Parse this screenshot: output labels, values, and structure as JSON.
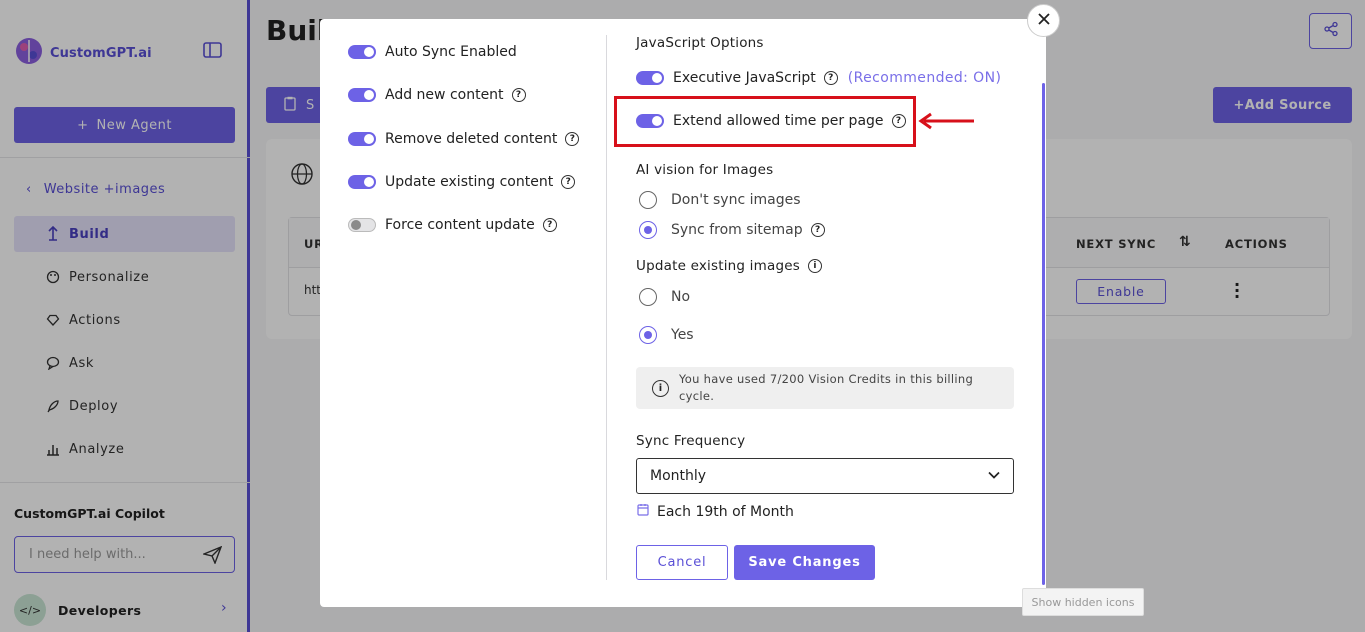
{
  "app": {
    "brand": "CustomGPT.ai",
    "accent": "#6d62e6",
    "highlight": "#d7101a"
  },
  "sidebar": {
    "new_agent": "New Agent",
    "back_link": "Website +images",
    "items": [
      {
        "label": "Build",
        "icon": "build-icon",
        "active": true
      },
      {
        "label": "Personalize",
        "icon": "palette-icon"
      },
      {
        "label": "Actions",
        "icon": "actions-icon"
      },
      {
        "label": "Ask",
        "icon": "chat-icon"
      },
      {
        "label": "Deploy",
        "icon": "rocket-icon"
      },
      {
        "label": "Analyze",
        "icon": "chart-icon"
      }
    ],
    "copilot": {
      "title": "CustomGPT.ai Copilot",
      "placeholder": "I need help with..."
    },
    "developers": {
      "avatar": "</>",
      "label": "Developers"
    }
  },
  "main": {
    "title": "Build",
    "tab": "S",
    "add_source": "Add Source",
    "table": {
      "headers": {
        "url": "UR",
        "next_sync": "NEXT SYNC",
        "actions": "ACTIONS"
      },
      "row": {
        "url": "htt",
        "enable": "Enable"
      }
    }
  },
  "modal": {
    "left_options": [
      {
        "label": "Auto Sync Enabled",
        "on": true,
        "help": false
      },
      {
        "label": "Add new content",
        "on": true,
        "help": true
      },
      {
        "label": "Remove deleted content",
        "on": true,
        "help": true
      },
      {
        "label": "Update existing content",
        "on": true,
        "help": true
      },
      {
        "label": "Force content update",
        "on": false,
        "help": true
      }
    ],
    "js": {
      "title": "JavaScript Options",
      "execute": "Executive JavaScript",
      "recommended": "(Recommended: ON)",
      "extend": "Extend allowed time per page"
    },
    "vision": {
      "title": "AI vision for Images",
      "options": [
        "Don't sync images",
        "Sync from sitemap"
      ],
      "selected": 1
    },
    "update_images": {
      "title": "Update existing images",
      "options": [
        "No",
        "Yes"
      ],
      "selected": 1
    },
    "notice": "You have used 7/200 Vision Credits in this billing cycle.",
    "frequency": {
      "title": "Sync Frequency",
      "value": "Monthly",
      "schedule": "Each 19th of Month"
    },
    "cancel": "Cancel",
    "save": "Save Changes"
  },
  "tooltip": "Show hidden icons"
}
